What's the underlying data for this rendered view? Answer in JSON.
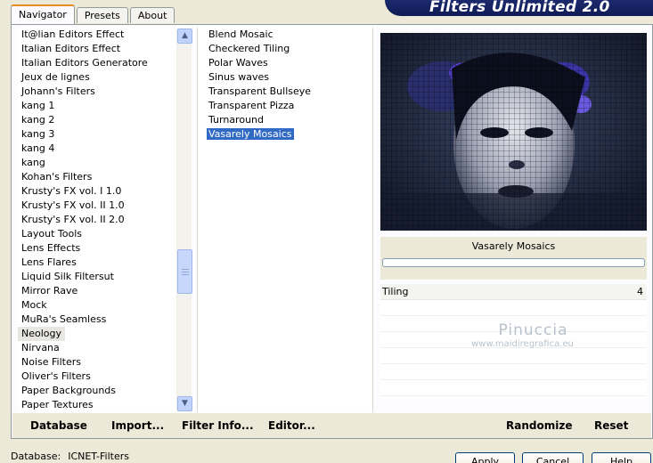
{
  "tabs": [
    "Navigator",
    "Presets",
    "About"
  ],
  "banner_title": "Filters Unlimited 2.0",
  "categories": [
    "It@lian Editors Effect",
    "Italian Editors Effect",
    "Italian Editors Generatore",
    "Jeux de lignes",
    "Johann's Filters",
    "kang 1",
    "kang 2",
    "kang 3",
    "kang 4",
    "kang",
    "Kohan's Filters",
    "Krusty's FX vol. I 1.0",
    "Krusty's FX vol. II 1.0",
    "Krusty's FX vol. II 2.0",
    "Layout Tools",
    "Lens Effects",
    "Lens Flares",
    "Liquid Silk Filtersut",
    "Mirror Rave",
    "Mock",
    "MuRa's Seamless",
    "Neology",
    "Nirvana",
    "Noise Filters",
    "Oliver's Filters",
    "Paper Backgrounds",
    "Paper Textures"
  ],
  "selected_category": "Neology",
  "effects": [
    "Blend Mosaic",
    "Checkered Tiling",
    "Polar Waves",
    "Sinus waves",
    "Transparent Bullseye",
    "Transparent Pizza",
    "Turnaround",
    "Vasarely Mosaics"
  ],
  "selected_effect": "Vasarely Mosaics",
  "preview": {
    "filter_name": "Vasarely Mosaics"
  },
  "params": [
    {
      "label": "Tiling",
      "value": "4"
    }
  ],
  "watermark": {
    "line1": "Pinuccia",
    "line2": "www.maidiregrafica.eu"
  },
  "bottom_buttons": {
    "database": "Database",
    "import": "Import...",
    "filter_info": "Filter Info...",
    "editor": "Editor...",
    "randomize": "Randomize",
    "reset": "Reset"
  },
  "status": {
    "label": "Database:",
    "value": "ICNET-Filters"
  },
  "dialog_buttons": {
    "apply": "Apply",
    "cancel": "Cancel",
    "help": "Help"
  },
  "colors": {
    "selection": "#316ac5",
    "banner": "#142163",
    "tab_active_accent": "#e68b2c"
  }
}
